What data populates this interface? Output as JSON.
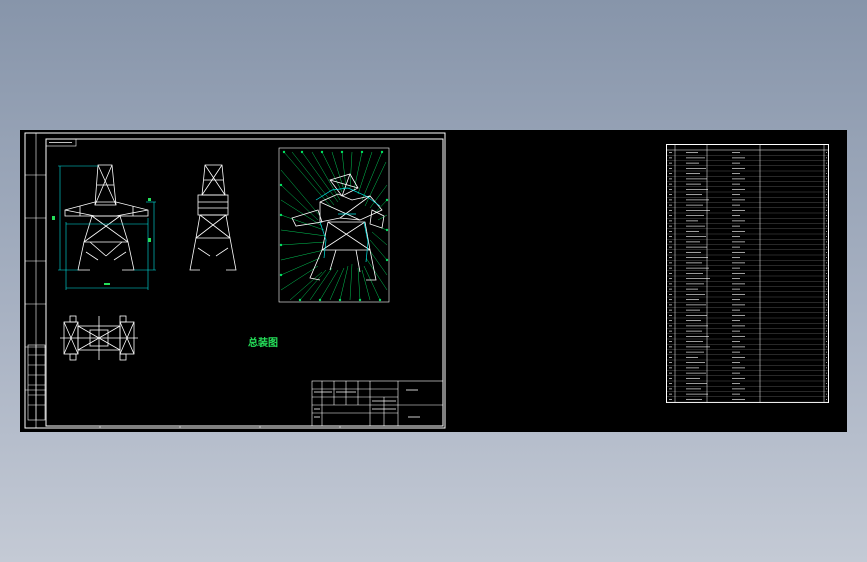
{
  "drawing": {
    "title_cn": "总装图",
    "background": "#000000",
    "line_color": "#ffffff",
    "dimension_color": "#00e5e5",
    "leader_color": "#00e060",
    "title_color": "#25e05a"
  },
  "bom_rows": 48
}
